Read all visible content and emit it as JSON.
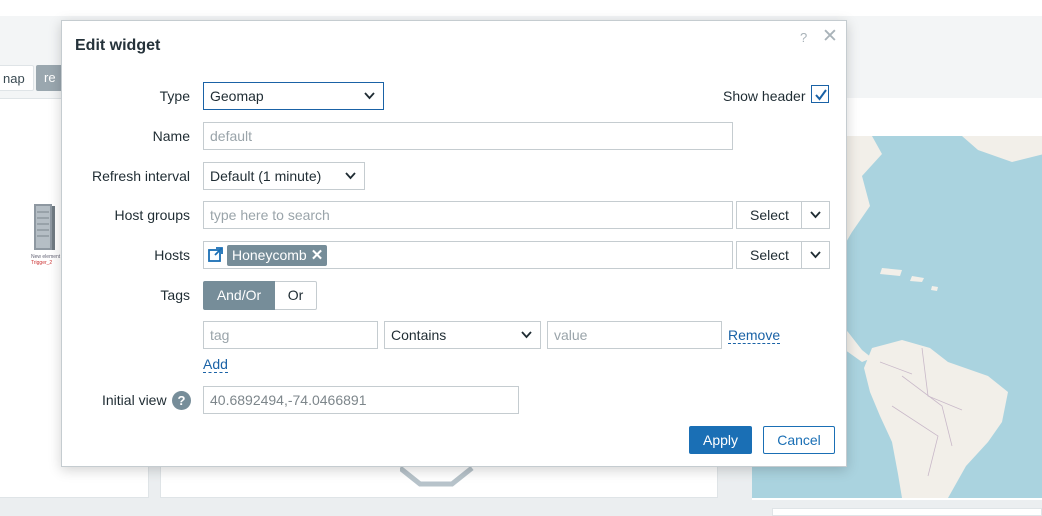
{
  "background": {
    "tab_map_label": "nap",
    "tab_re_label": "re",
    "server_caption": "New element",
    "server_trigger": "Trigger_2"
  },
  "dialog": {
    "title": "Edit widget",
    "help_glyph": "?",
    "close_glyph": "✕",
    "type": {
      "label": "Type",
      "value": "Geomap"
    },
    "show_header": {
      "label": "Show header",
      "checked": true
    },
    "name": {
      "label": "Name",
      "value": "",
      "placeholder": "default"
    },
    "refresh_interval": {
      "label": "Refresh interval",
      "value": "Default (1 minute)"
    },
    "host_groups": {
      "label": "Host groups",
      "value": "",
      "placeholder": "type here to search",
      "select_label": "Select"
    },
    "hosts": {
      "label": "Hosts",
      "chips": [
        "Honeycomb"
      ],
      "chip_remove_glyph": "✕",
      "select_label": "Select"
    },
    "tags": {
      "label": "Tags",
      "operator_options": [
        "And/Or",
        "Or"
      ],
      "operator_selected": "And/Or",
      "rows": [
        {
          "tag_placeholder": "tag",
          "operator": "Contains",
          "value_placeholder": "value",
          "remove_label": "Remove"
        }
      ],
      "add_label": "Add"
    },
    "initial_view": {
      "label": "Initial view",
      "help_glyph": "?",
      "value": "40.6892494,-74.0466891"
    },
    "apply_label": "Apply",
    "cancel_label": "Cancel"
  },
  "colors": {
    "accent": "#1a6fb5",
    "chip_bg": "#768d99",
    "border": "#c5ccd0"
  }
}
